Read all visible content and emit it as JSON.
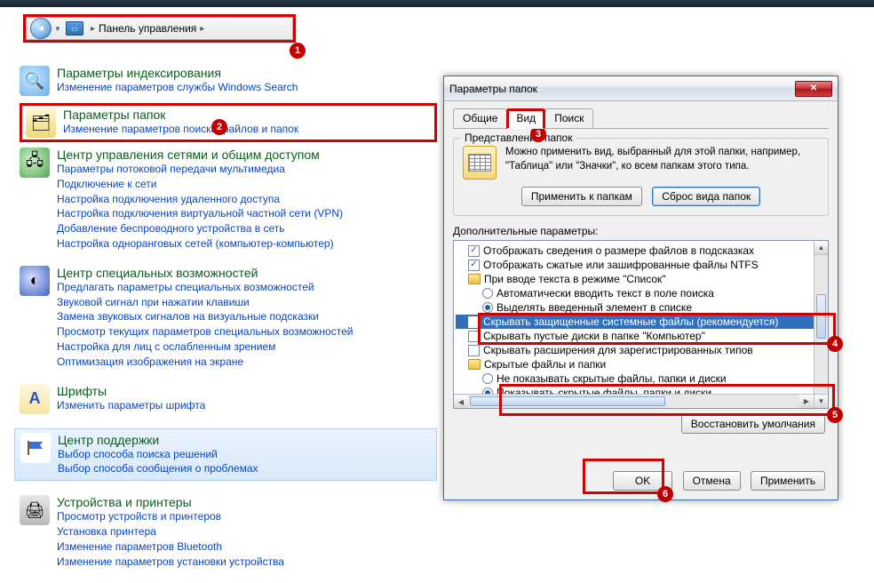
{
  "addressbar": {
    "label": "Панель управления"
  },
  "cp": {
    "indexing": {
      "title": "Параметры индексирования",
      "link": "Изменение параметров службы Windows Search"
    },
    "folder": {
      "title": "Параметры папок",
      "link": "Изменение параметров поиска файлов и папок"
    },
    "network": {
      "title": "Центр управления сетями и общим доступом",
      "links": [
        "Параметры потоковой передачи мультимедиа",
        "Подключение к сети",
        "Настройка подключения удаленного доступа",
        "Настройка подключения виртуальной частной сети (VPN)",
        "Добавление беспроводного устройства в сеть",
        "Настройка одноранговых сетей (компьютер-компьютер)"
      ]
    },
    "access": {
      "title": "Центр специальных возможностей",
      "links": [
        "Предлагать параметры специальных возможностей",
        "Звуковой сигнал при нажатии клавиши",
        "Замена звуковых сигналов на визуальные подсказки",
        "Просмотр текущих параметров специальных возможностей",
        "Настройка для лиц с ослабленным зрением",
        "Оптимизация изображения на экране"
      ]
    },
    "fonts": {
      "title": "Шрифты",
      "link": "Изменить параметры шрифта"
    },
    "support": {
      "title": "Центр поддержки",
      "links": [
        "Выбор способа поиска решений",
        "Выбор способа сообщения о проблемах"
      ]
    },
    "devices": {
      "title": "Устройства и принтеры",
      "links": [
        "Просмотр устройств и принтеров",
        "Установка принтера",
        "Изменение параметров Bluetooth",
        "Изменение параметров установки устройства"
      ]
    }
  },
  "dialog": {
    "title": "Параметры папок",
    "tabs": {
      "general": "Общие",
      "view": "Вид",
      "search": "Поиск"
    },
    "folderview": {
      "legend": "Представление папок",
      "text": "Можно применить вид, выбранный для этой папки, например, \"Таблица\" или \"Значки\", ко всем папкам этого типа.",
      "apply": "Применить к папкам",
      "reset": "Сброс вида папок"
    },
    "advanced": {
      "label": "Дополнительные параметры:",
      "items": {
        "size_hint": "Отображать сведения о размере файлов в подсказках",
        "compressed": "Отображать сжатые или зашифрованные файлы NTFS",
        "typing": "При вводе текста в режиме \"Список\"",
        "auto_enter": "Автоматически вводить текст в поле поиска",
        "highlight": "Выделять введенный элемент в списке",
        "hide_sys": "Скрывать защищенные системные файлы (рекомендуется)",
        "hide_empty": "Скрывать пустые диски в папке \"Компьютер\"",
        "hide_ext": "Скрывать расширения для зарегистрированных типов",
        "hidden_grp": "Скрытые файлы и папки",
        "dont_show": "Не показывать скрытые файлы, папки и диски",
        "show_hidden": "Показывать скрытые файлы, папки и диски"
      },
      "restore": "Восстановить умолчания"
    },
    "buttons": {
      "ok": "OK",
      "cancel": "Отмена",
      "apply": "Применить"
    }
  },
  "callouts": {
    "c1": "1",
    "c2": "2",
    "c3": "3",
    "c4": "4",
    "c5": "5",
    "c6": "6"
  }
}
